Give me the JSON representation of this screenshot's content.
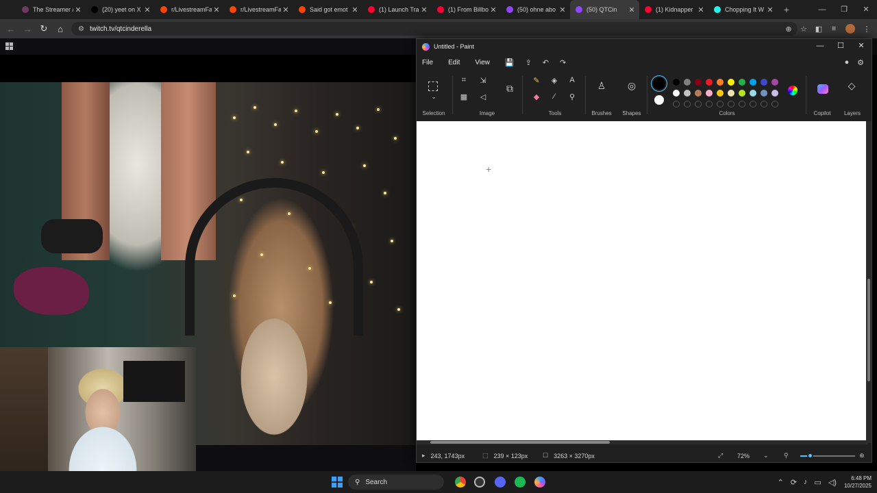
{
  "browser": {
    "tabs": [
      {
        "title": "The Streamer /",
        "color": "#6e3b5c"
      },
      {
        "title": "(20) yeet on X",
        "color": "#000000"
      },
      {
        "title": "r/LivestreamFa",
        "color": "#ff4500"
      },
      {
        "title": "r/LivestreamFa",
        "color": "#ff4500"
      },
      {
        "title": "Said got emot",
        "color": "#ff4500"
      },
      {
        "title": "(1) Launch Tra",
        "color": "#ff0033"
      },
      {
        "title": "(1) From Billbo",
        "color": "#ff0033"
      },
      {
        "title": "(50) ohne abo",
        "color": "#9146ff"
      },
      {
        "title": "(50) QTCin",
        "color": "#9146ff"
      },
      {
        "title": "(1) Kidnapper",
        "color": "#ff0033"
      },
      {
        "title": "Chopping It W",
        "color": "#25f4ee"
      }
    ],
    "active_tab_index": 8,
    "url": "twitch.tv/qtcinderella"
  },
  "paint": {
    "window_title": "Untitled - Paint",
    "menu": {
      "file": "File",
      "edit": "Edit",
      "view": "View"
    },
    "groups": {
      "selection": "Selection",
      "image": "Image",
      "tools": "Tools",
      "brushes": "Brushes",
      "shapes": "Shapes",
      "colors": "Colors",
      "copilot": "Copilot",
      "layers": "Layers"
    },
    "palette_row1": [
      "#000000",
      "#7f7f7f",
      "#880015",
      "#ed1c24",
      "#ff7f27",
      "#fff200",
      "#22b14c",
      "#00a2e8",
      "#3f48cc",
      "#a349a4"
    ],
    "palette_row2": [
      "#ffffff",
      "#c3c3c3",
      "#b97a57",
      "#ffaec9",
      "#ffc90e",
      "#efe4b0",
      "#b5e61d",
      "#99d9ea",
      "#7092be",
      "#c8bfe7"
    ],
    "primary_color": "#000000",
    "secondary_color": "#ffffff",
    "status": {
      "cursor_pos": "243, 1743px",
      "selection_size": "239 × 123px",
      "canvas_size": "3263 × 3270px",
      "zoom": "72%"
    },
    "zoom_fraction": 0.18
  },
  "taskbar": {
    "search": "Search",
    "time": "6:48 PM",
    "date": "10/27/2025"
  }
}
